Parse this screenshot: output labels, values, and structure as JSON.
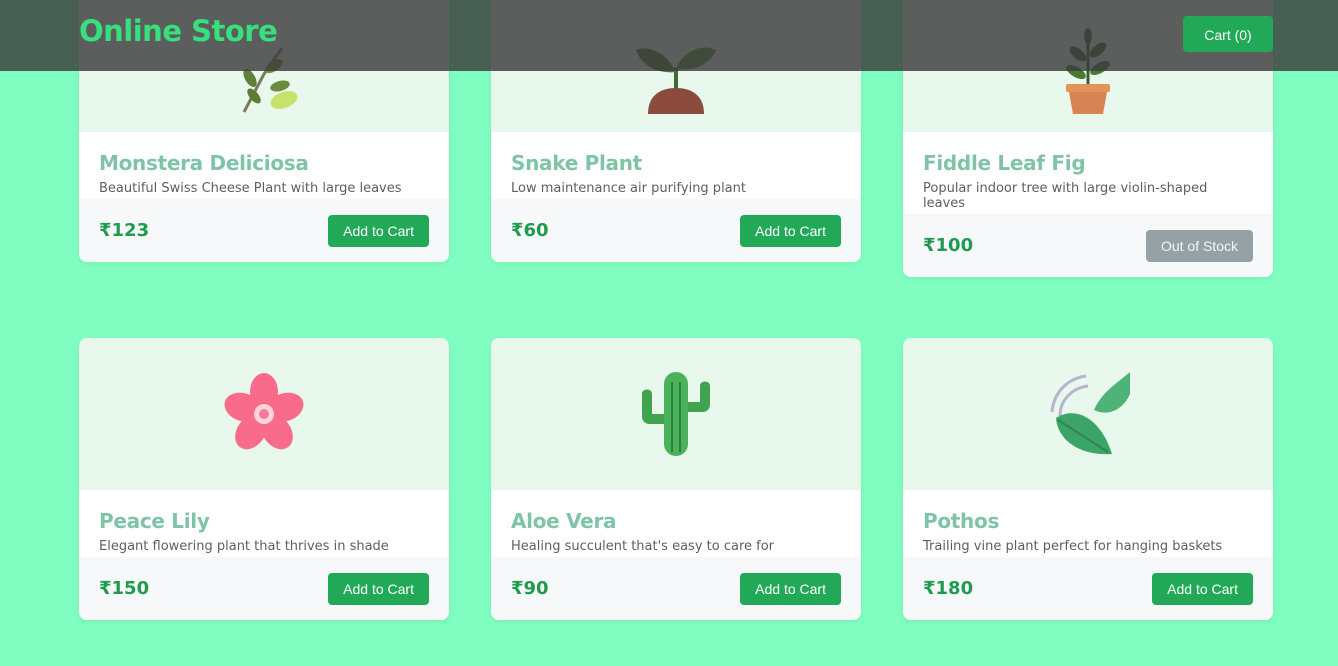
{
  "header": {
    "brand": "Online Store",
    "cart_label": "Cart (0)"
  },
  "products": [
    {
      "name": "Monstera Deliciosa",
      "description": "Beautiful Swiss Cheese Plant with large leaves",
      "price": "₹123",
      "action": "Add to Cart",
      "icon": "branch-leaves-icon"
    },
    {
      "name": "Snake Plant",
      "description": "Low maintenance air purifying plant",
      "price": "₹60",
      "action": "Add to Cart",
      "icon": "seedling-icon"
    },
    {
      "name": "Fiddle Leaf Fig",
      "description": "Popular indoor tree with large violin-shaped leaves",
      "price": "₹100",
      "action": "Out of Stock",
      "icon": "potted-plant-icon"
    },
    {
      "name": "Peace Lily",
      "description": "Elegant flowering plant that thrives in shade",
      "price": "₹150",
      "action": "Add to Cart",
      "icon": "cherry-blossom-icon"
    },
    {
      "name": "Aloe Vera",
      "description": "Healing succulent that's easy to care for",
      "price": "₹90",
      "action": "Add to Cart",
      "icon": "cactus-icon"
    },
    {
      "name": "Pothos",
      "description": "Trailing vine plant perfect for hanging baskets",
      "price": "₹180",
      "action": "Add to Cart",
      "icon": "leaf-fluttering-icon"
    }
  ],
  "colors": {
    "page_background": "#80fdc1",
    "brand": "#37e07c",
    "accent": "#21a957",
    "price": "#1f9a4f",
    "title": "#7fc4a6",
    "disabled": "#95a2a5"
  }
}
